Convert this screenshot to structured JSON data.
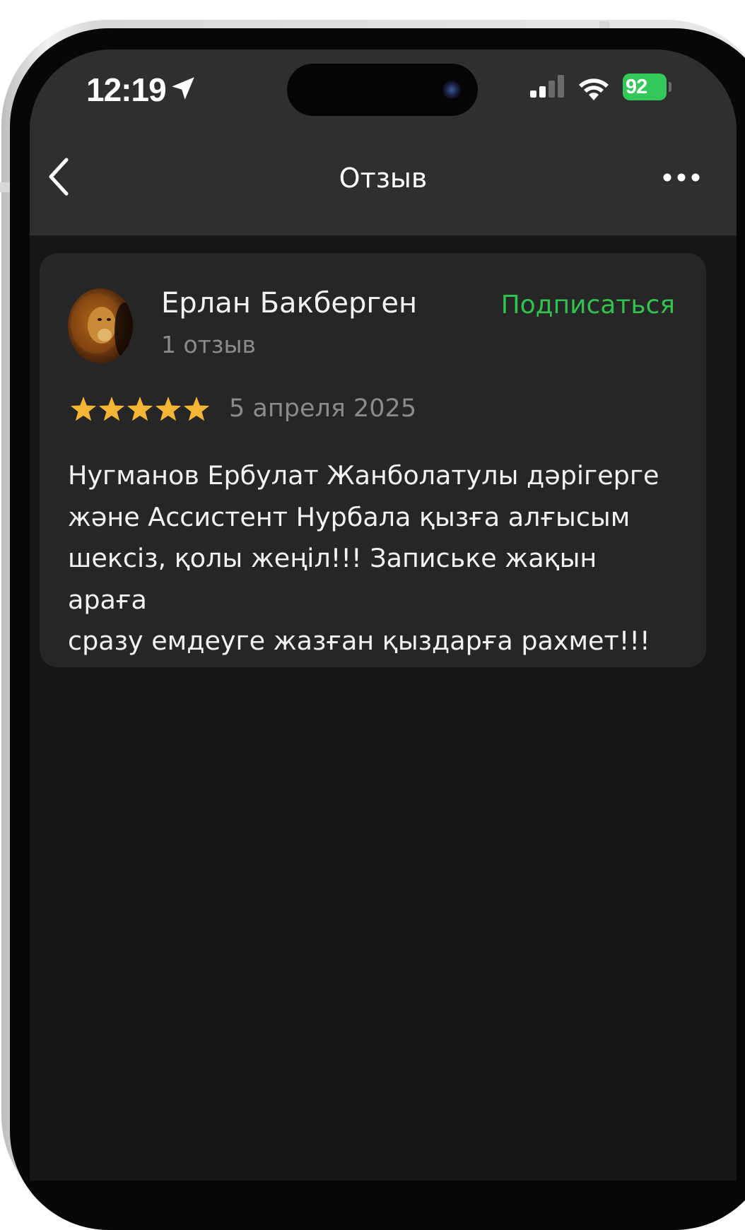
{
  "status_bar": {
    "time": "12:19",
    "battery": "92"
  },
  "nav": {
    "title": "Отзыв"
  },
  "review": {
    "author_name": "Ерлан Бакберген",
    "review_count": "1 отзыв",
    "subscribe_label": "Подписаться",
    "rating": 5,
    "rating_max": 5,
    "date": "5 апреля 2025",
    "text": "Нугманов Ербулат Жанболатулы дәрігерге\nжәне Ассистент Нурбала қызға алғысым\nшексіз, қолы жеңіл!!! Запиське жақын араға\nсразу емдеуге жазған қыздарға рахмет!!!"
  },
  "colors": {
    "accent": "#31c24e",
    "star": "#f5b534",
    "background": "#161616",
    "card": "#262626",
    "header": "#2f2f2f"
  },
  "icons": [
    "location-arrow-icon",
    "cellular-signal-icon",
    "wifi-icon",
    "battery-icon",
    "back-chevron-icon",
    "more-dots-icon",
    "star-icon"
  ]
}
